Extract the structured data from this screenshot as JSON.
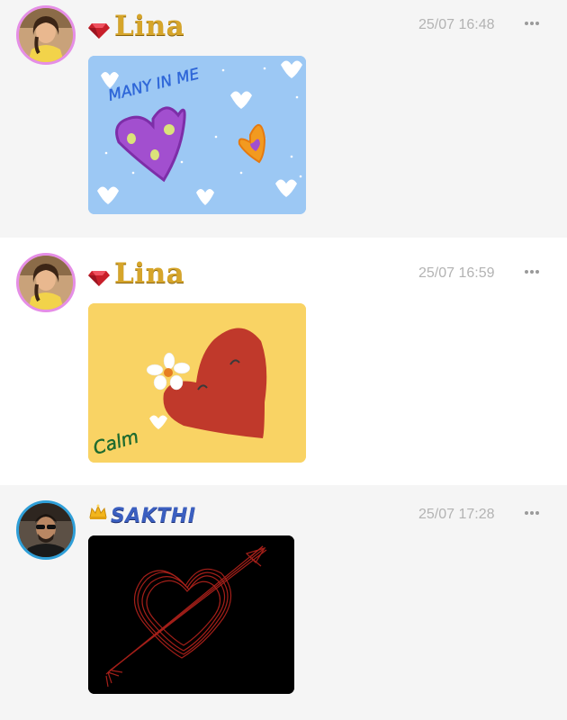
{
  "posts": [
    {
      "username": "Lina",
      "badge_icon": "ruby-gem-icon",
      "timestamp": "25/07 16:48",
      "drawing_text": "MANY IN ME",
      "card_color": "#9cc8f4"
    },
    {
      "username": "Lina",
      "badge_icon": "ruby-gem-icon",
      "timestamp": "25/07 16:59",
      "drawing_text": "Calm",
      "card_color": "#f9d364"
    },
    {
      "username": "SAKTHI",
      "badge_icon": "crown-icon",
      "timestamp": "25/07 17:28",
      "drawing_text": "",
      "card_color": "#000000"
    }
  ],
  "colors": {
    "gold_name": "#d6a52a",
    "blue_name": "#3b5fc0",
    "timestamp": "#b3b3b3",
    "avatar_ring_pink": "#e58ee6",
    "avatar_ring_blue": "#2f9fd8"
  }
}
